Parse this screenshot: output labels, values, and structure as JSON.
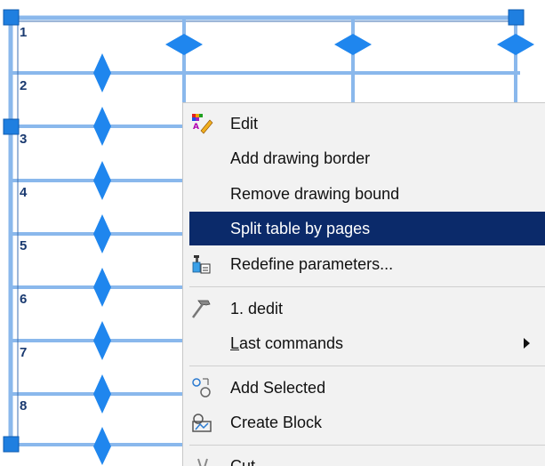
{
  "table": {
    "row_labels": [
      "1",
      "2",
      "3",
      "4",
      "5",
      "6",
      "7",
      "8"
    ]
  },
  "menu": {
    "items": [
      {
        "label": "Edit",
        "icon": "edit-palette-icon"
      },
      {
        "label": "Add drawing border",
        "icon": ""
      },
      {
        "label": "Remove drawing bound",
        "icon": ""
      },
      {
        "label": "Split table by pages",
        "icon": "",
        "highlighted": true
      },
      {
        "label": "Redefine parameters...",
        "icon": "redefine-parameters-icon"
      },
      {
        "label": "1. dedit",
        "icon": "hammer-icon"
      },
      {
        "label_underlined": "L",
        "label_rest": "ast commands",
        "icon": "",
        "submenu": true
      },
      {
        "label": "Add Selected",
        "icon": "add-selected-icon"
      },
      {
        "label": "Create Block",
        "icon": "create-block-icon"
      },
      {
        "label": "Cut",
        "icon": "cut-icon"
      }
    ]
  },
  "colors": {
    "grip_blue": "#1f7fe0",
    "grid_blue": "#7fb2e8",
    "highlight": "#0b2a6a",
    "menu_bg": "#f2f2f2"
  }
}
